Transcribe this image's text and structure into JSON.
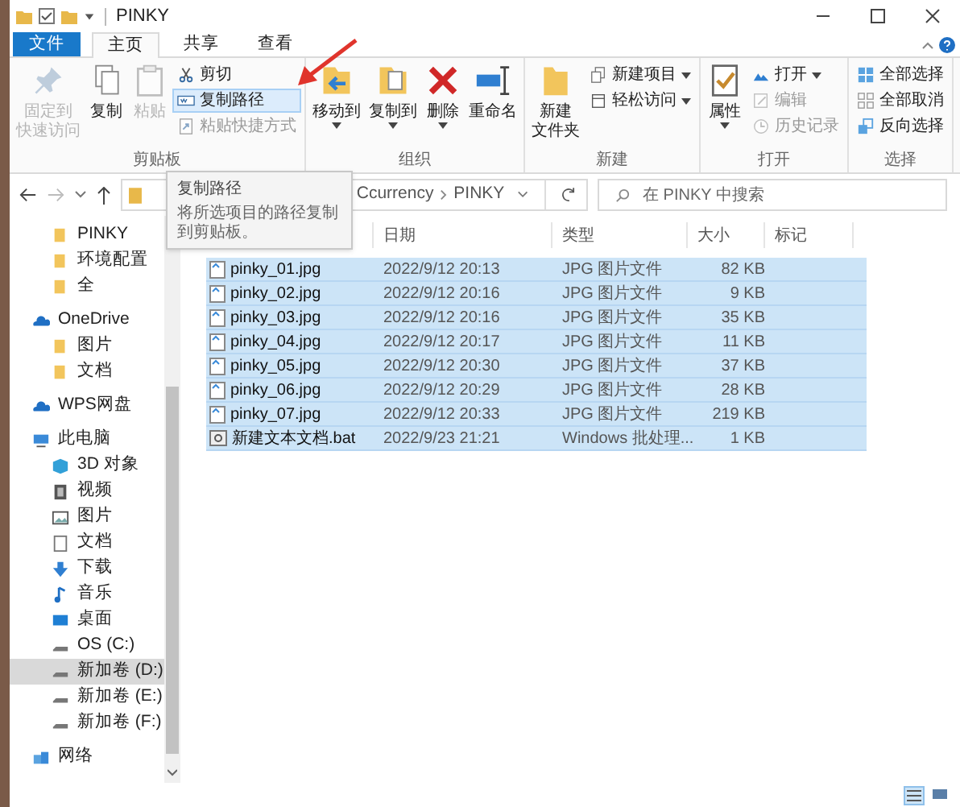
{
  "window": {
    "title": "PINKY"
  },
  "tabs": [
    {
      "label": "文件",
      "kind": "file-menu",
      "selected": false
    },
    {
      "label": "主页",
      "kind": "tab",
      "selected": true
    },
    {
      "label": "共享",
      "kind": "tab",
      "selected": false
    },
    {
      "label": "查看",
      "kind": "tab",
      "selected": false
    }
  ],
  "ribbon": {
    "groups": [
      {
        "label": "剪贴板",
        "items": [
          {
            "kind": "large",
            "lines": [
              "固定到",
              "快速访问"
            ],
            "disabled": true,
            "dropdown": false
          },
          {
            "kind": "large",
            "lines": [
              "复制"
            ],
            "disabled": false,
            "dropdown": false
          },
          {
            "kind": "large",
            "lines": [
              "粘贴"
            ],
            "disabled": true,
            "dropdown": false
          },
          {
            "kind": "small",
            "label": "剪切",
            "disabled": false,
            "highlighted": false,
            "dropdown": false
          },
          {
            "kind": "small",
            "label": "复制路径",
            "disabled": false,
            "highlighted": true,
            "dropdown": false
          },
          {
            "kind": "small",
            "label": "粘贴快捷方式",
            "disabled": true,
            "highlighted": false,
            "dropdown": false
          }
        ]
      },
      {
        "label": "组织",
        "items": [
          {
            "kind": "large",
            "lines": [
              "移动到"
            ],
            "disabled": false,
            "dropdown": true
          },
          {
            "kind": "large",
            "lines": [
              "复制到"
            ],
            "disabled": false,
            "dropdown": true
          },
          {
            "kind": "large",
            "lines": [
              "删除"
            ],
            "disabled": false,
            "dropdown": true
          },
          {
            "kind": "large",
            "lines": [
              "重命名"
            ],
            "disabled": false,
            "dropdown": false
          }
        ]
      },
      {
        "label": "新建",
        "items": [
          {
            "kind": "large",
            "lines": [
              "新建",
              "文件夹"
            ],
            "disabled": false,
            "dropdown": false
          },
          {
            "kind": "small",
            "label": "新建项目",
            "disabled": false,
            "highlighted": false,
            "dropdown": true
          },
          {
            "kind": "small",
            "label": "轻松访问",
            "disabled": false,
            "highlighted": false,
            "dropdown": true
          }
        ]
      },
      {
        "label": "打开",
        "items": [
          {
            "kind": "large",
            "lines": [
              "属性"
            ],
            "disabled": false,
            "dropdown": true
          },
          {
            "kind": "small",
            "label": "打开",
            "disabled": false,
            "highlighted": false,
            "dropdown": true
          },
          {
            "kind": "small",
            "label": "编辑",
            "disabled": true,
            "highlighted": false,
            "dropdown": false
          },
          {
            "kind": "small",
            "label": "历史记录",
            "disabled": true,
            "highlighted": false,
            "dropdown": false
          }
        ]
      },
      {
        "label": "选择",
        "items": [
          {
            "kind": "small",
            "label": "全部选择",
            "disabled": false,
            "highlighted": false,
            "dropdown": false
          },
          {
            "kind": "small",
            "label": "全部取消",
            "disabled": false,
            "highlighted": false,
            "dropdown": false
          },
          {
            "kind": "small",
            "label": "反向选择",
            "disabled": false,
            "highlighted": false,
            "dropdown": false
          }
        ]
      }
    ]
  },
  "address_bar": {
    "segments": [
      "Ccurrency",
      "PINKY"
    ]
  },
  "search": {
    "placeholder": "在 PINKY 中搜索"
  },
  "tooltip": {
    "title": "复制路径",
    "text": "将所选项目的路径复制到剪贴板。"
  },
  "navigation": {
    "items": [
      {
        "kind": "group",
        "children": [
          {
            "label": "PINKY",
            "kind": "folder",
            "selected": false
          },
          {
            "label": "环境配置",
            "kind": "folder",
            "selected": false
          },
          {
            "label": "全",
            "kind": "folder",
            "selected": false
          }
        ]
      },
      {
        "label": "OneDrive",
        "kind": "cloud",
        "selected": false,
        "children": [
          {
            "label": "图片",
            "kind": "folder",
            "selected": false
          },
          {
            "label": "文档",
            "kind": "folder",
            "selected": false
          }
        ]
      },
      {
        "label": "WPS网盘",
        "kind": "cloud",
        "selected": false
      },
      {
        "label": "此电脑",
        "kind": "pc",
        "selected": false,
        "children": [
          {
            "label": "3D 对象",
            "kind": "cube",
            "selected": false
          },
          {
            "label": "视频",
            "kind": "video",
            "selected": false
          },
          {
            "label": "图片",
            "kind": "pictures",
            "selected": false
          },
          {
            "label": "文档",
            "kind": "documents",
            "selected": false
          },
          {
            "label": "下载",
            "kind": "download",
            "selected": false
          },
          {
            "label": "音乐",
            "kind": "music",
            "selected": false
          },
          {
            "label": "桌面",
            "kind": "desktop",
            "selected": false
          },
          {
            "label": "OS (C:)",
            "kind": "drive",
            "selected": false
          },
          {
            "label": "新加卷 (D:)",
            "kind": "drive",
            "selected": true
          },
          {
            "label": "新加卷 (E:)",
            "kind": "drive",
            "selected": false
          },
          {
            "label": "新加卷 (F:)",
            "kind": "drive",
            "selected": false
          }
        ]
      },
      {
        "label": "网络",
        "kind": "network",
        "selected": false
      }
    ]
  },
  "table": {
    "columns": [
      "日期",
      "类型",
      "大小",
      "标记"
    ],
    "rows": [
      {
        "kind": "image",
        "name": "pinky_01.jpg",
        "date": "2022/9/12 20:13",
        "type": "JPG 图片文件",
        "size": "82 KB",
        "selected": true
      },
      {
        "kind": "image",
        "name": "pinky_02.jpg",
        "date": "2022/9/12 20:16",
        "type": "JPG 图片文件",
        "size": "9 KB",
        "selected": true
      },
      {
        "kind": "image",
        "name": "pinky_03.jpg",
        "date": "2022/9/12 20:16",
        "type": "JPG 图片文件",
        "size": "35 KB",
        "selected": true
      },
      {
        "kind": "image",
        "name": "pinky_04.jpg",
        "date": "2022/9/12 20:17",
        "type": "JPG 图片文件",
        "size": "11 KB",
        "selected": true
      },
      {
        "kind": "image",
        "name": "pinky_05.jpg",
        "date": "2022/9/12 20:30",
        "type": "JPG 图片文件",
        "size": "37 KB",
        "selected": true
      },
      {
        "kind": "image",
        "name": "pinky_06.jpg",
        "date": "2022/9/12 20:29",
        "type": "JPG 图片文件",
        "size": "28 KB",
        "selected": true
      },
      {
        "kind": "image",
        "name": "pinky_07.jpg",
        "date": "2022/9/12 20:33",
        "type": "JPG 图片文件",
        "size": "219 KB",
        "selected": true
      },
      {
        "kind": "batch",
        "name": "新建文本文档.bat",
        "date": "2022/9/23 21:21",
        "type": "Windows 批处理...",
        "size": "1 KB",
        "selected": true
      }
    ]
  },
  "status_bar": {
    "views": [
      {
        "kind": "details",
        "selected": true
      },
      {
        "kind": "large-icons",
        "selected": false
      }
    ]
  }
}
